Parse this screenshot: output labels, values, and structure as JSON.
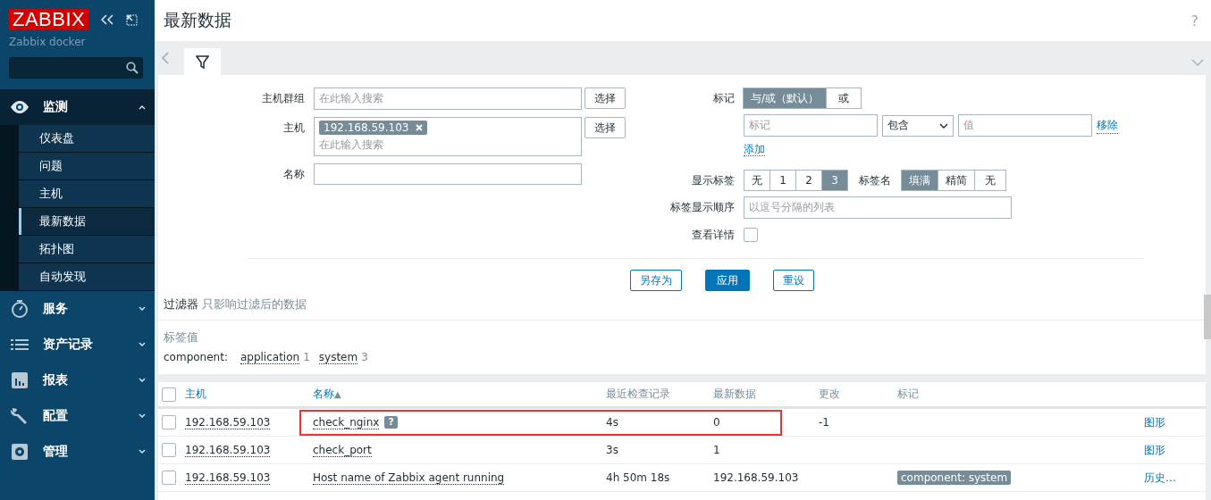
{
  "sidebar": {
    "logo": "ZABBIX",
    "server": "Zabbix docker",
    "menu": [
      {
        "label": "监测",
        "expanded": true,
        "children": [
          {
            "label": "仪表盘",
            "selected": false
          },
          {
            "label": "问题",
            "selected": false
          },
          {
            "label": "主机",
            "selected": false
          },
          {
            "label": "最新数据",
            "selected": true
          },
          {
            "label": "拓扑图",
            "selected": false
          },
          {
            "label": "自动发现",
            "selected": false
          }
        ]
      },
      {
        "label": "服务",
        "expanded": false
      },
      {
        "label": "资产记录",
        "expanded": false
      },
      {
        "label": "报表",
        "expanded": false
      },
      {
        "label": "配置",
        "expanded": false
      },
      {
        "label": "管理",
        "expanded": false
      }
    ]
  },
  "page": {
    "title": "最新数据",
    "help": "?"
  },
  "filter": {
    "left": [
      {
        "kind": "multiselect",
        "label": "主机群组",
        "placeholder": "在此输入搜索",
        "button": "选择"
      },
      {
        "kind": "multiselect",
        "label": "主机",
        "chips": [
          "192.168.59.103"
        ],
        "placeholder": "在此输入搜索",
        "button": "选择"
      },
      {
        "kind": "text",
        "label": "名称"
      }
    ],
    "tags": {
      "label": "标记",
      "modes": [
        {
          "label": "与/或（默认）",
          "selected": true
        },
        {
          "label": "或",
          "selected": false
        }
      ],
      "tag_placeholder": "标记",
      "operator": "包含",
      "value_placeholder": "值",
      "remove": "移除",
      "add": "添加"
    },
    "show_tags": {
      "label": "显示标签",
      "options": [
        {
          "label": "无",
          "selected": false
        },
        {
          "label": "1",
          "selected": false
        },
        {
          "label": "2",
          "selected": false
        },
        {
          "label": "3",
          "selected": true
        }
      ]
    },
    "tag_name": {
      "label": "标签名",
      "options": [
        {
          "label": "填满",
          "selected": true
        },
        {
          "label": "精简",
          "selected": false
        },
        {
          "label": "无",
          "selected": false
        }
      ]
    },
    "tag_order": {
      "label": "标签显示顺序",
      "placeholder": "以逗号分隔的列表"
    },
    "details": {
      "label": "查看详情",
      "checked": false
    },
    "buttons": [
      {
        "label": "另存为",
        "primary": false
      },
      {
        "label": "应用",
        "primary": true
      },
      {
        "label": "重设",
        "primary": false
      }
    ],
    "note": {
      "title": "过滤器",
      "text": "只影响过滤后的数据"
    }
  },
  "tag_values": {
    "title": "标签值",
    "name": "component:",
    "values": [
      {
        "label": "application",
        "count": "1"
      },
      {
        "label": "system",
        "count": "3"
      }
    ]
  },
  "table": {
    "all_checked": false,
    "columns": [
      {
        "label": "主机",
        "link": true
      },
      {
        "label": "名称",
        "link": true,
        "sort": "▲"
      },
      {
        "label": "最近检查记录",
        "link": false
      },
      {
        "label": "最新数据",
        "link": false
      },
      {
        "label": "更改",
        "link": false
      },
      {
        "label": "标记",
        "link": false
      }
    ],
    "rows": [
      {
        "checked": false,
        "host": "192.168.59.103",
        "name": "check_nginx",
        "info": "?",
        "last_check": "4s",
        "last_value": "0",
        "change": "-1",
        "highlighted": true,
        "action": "图形"
      },
      {
        "checked": false,
        "host": "192.168.59.103",
        "name": "check_port",
        "last_check": "3s",
        "last_value": "1",
        "highlighted": false,
        "action": "图形"
      },
      {
        "checked": false,
        "host": "192.168.59.103",
        "name": "Host name of Zabbix agent running",
        "last_check": "4h 50m 18s",
        "last_value": "192.168.59.103",
        "tag": "component: system",
        "highlighted": false,
        "action": "历史…"
      }
    ]
  }
}
